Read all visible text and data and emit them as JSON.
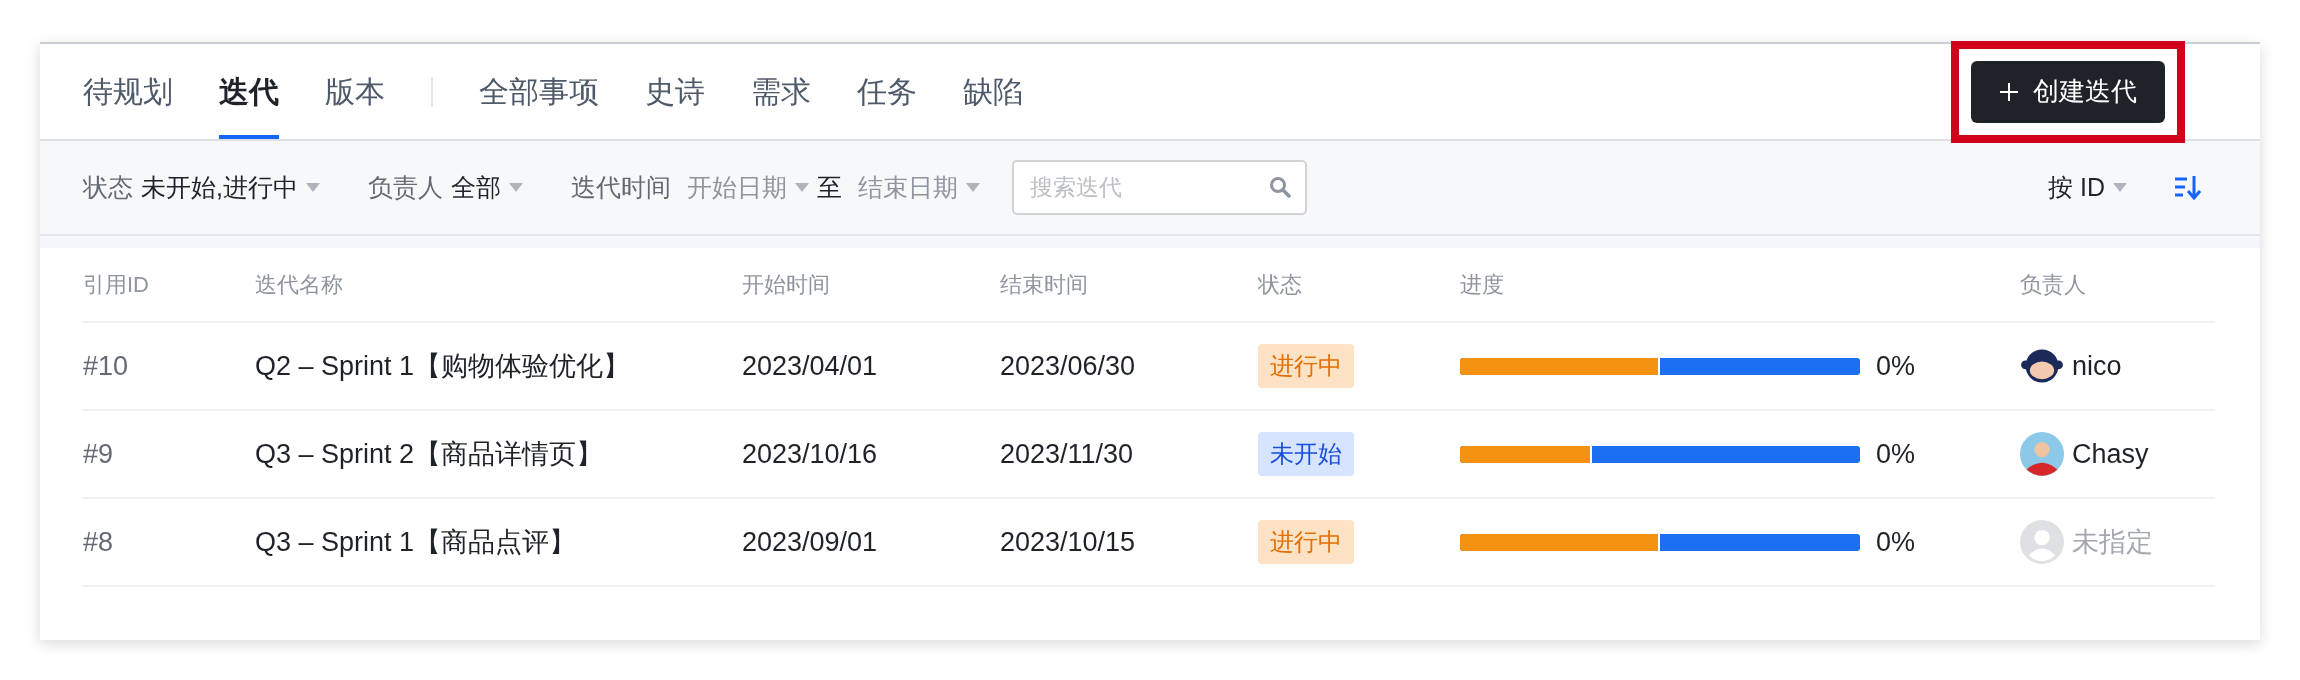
{
  "tabs": [
    {
      "label": "待规划",
      "selected": false
    },
    {
      "label": "迭代",
      "selected": true
    },
    {
      "label": "版本",
      "selected": false
    }
  ],
  "type_tabs": [
    {
      "label": "全部事项",
      "selected": false
    },
    {
      "label": "史诗",
      "selected": false
    },
    {
      "label": "需求",
      "selected": false
    },
    {
      "label": "任务",
      "selected": false
    },
    {
      "label": "缺陷",
      "selected": false
    }
  ],
  "create_button": {
    "label": "创建迭代",
    "highlighted": true
  },
  "filters": [
    {
      "label": "状态",
      "value": "未开始,进行中"
    },
    {
      "label": "负责人",
      "value": "全部"
    }
  ],
  "date_filter": {
    "label": "迭代时间",
    "start_placeholder": "开始日期",
    "separator": "至",
    "end_placeholder": "结束日期"
  },
  "search": {
    "placeholder": "搜索迭代"
  },
  "sort": {
    "label": "按 ID"
  },
  "table": {
    "columns": [
      "引用ID",
      "迭代名称",
      "开始时间",
      "结束时间",
      "状态",
      "进度",
      "负责人"
    ],
    "rows": [
      {
        "id": "#10",
        "name": "Q2 – Sprint 1【购物体验优化】",
        "start": "2023/04/01",
        "end": "2023/06/30",
        "status": {
          "label": "进行中",
          "kind": "in_progress"
        },
        "progress": {
          "level": 0.5,
          "reading": "0%"
        },
        "owner": {
          "name": "nico",
          "kind": "mascot"
        }
      },
      {
        "id": "#9",
        "name": "Q3 – Sprint 2【商品详情页】",
        "start": "2023/10/16",
        "end": "2023/11/30",
        "status": {
          "label": "未开始",
          "kind": "not_started"
        },
        "progress": {
          "level": 0.33,
          "reading": "0%"
        },
        "owner": {
          "name": "Chasy",
          "kind": "person"
        }
      },
      {
        "id": "#8",
        "name": "Q3 – Sprint 1【商品点评】",
        "start": "2023/09/01",
        "end": "2023/10/15",
        "status": {
          "label": "进行中",
          "kind": "in_progress"
        },
        "progress": {
          "level": 0.5,
          "reading": "0%"
        },
        "owner": {
          "name": "未指定",
          "kind": "unassigned"
        }
      }
    ]
  }
}
